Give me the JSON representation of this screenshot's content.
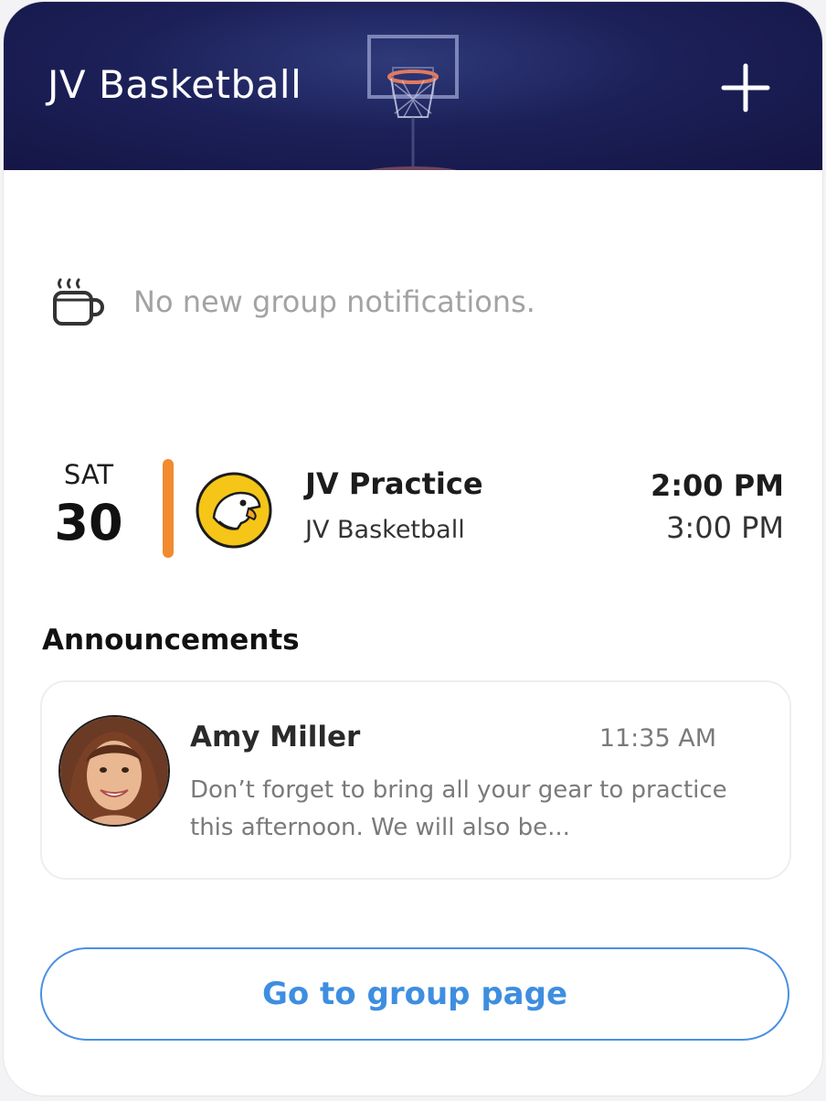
{
  "header": {
    "title": "JV Basketball",
    "add_icon": "plus-icon",
    "background_icon": "basketball-hoop-icon"
  },
  "notifications": {
    "icon": "coffee-cup-icon",
    "message": "No new group notifications."
  },
  "event": {
    "day_of_week": "SAT",
    "date": "30",
    "accent_color": "#f28a2f",
    "logo_icon": "eagle-mascot-icon",
    "title": "JV Practice",
    "group": "JV Basketball",
    "start_time": "2:00 PM",
    "end_time": "3:00 PM"
  },
  "announcements": {
    "heading": "Announcements",
    "items": [
      {
        "author": "Amy Miller",
        "time": "11:35 AM",
        "body": "Don’t forget to bring all your gear to practice this afternoon. We will also be..."
      }
    ]
  },
  "actions": {
    "group_page_label": "Go to group page",
    "accent_color": "#3e8ee0"
  }
}
